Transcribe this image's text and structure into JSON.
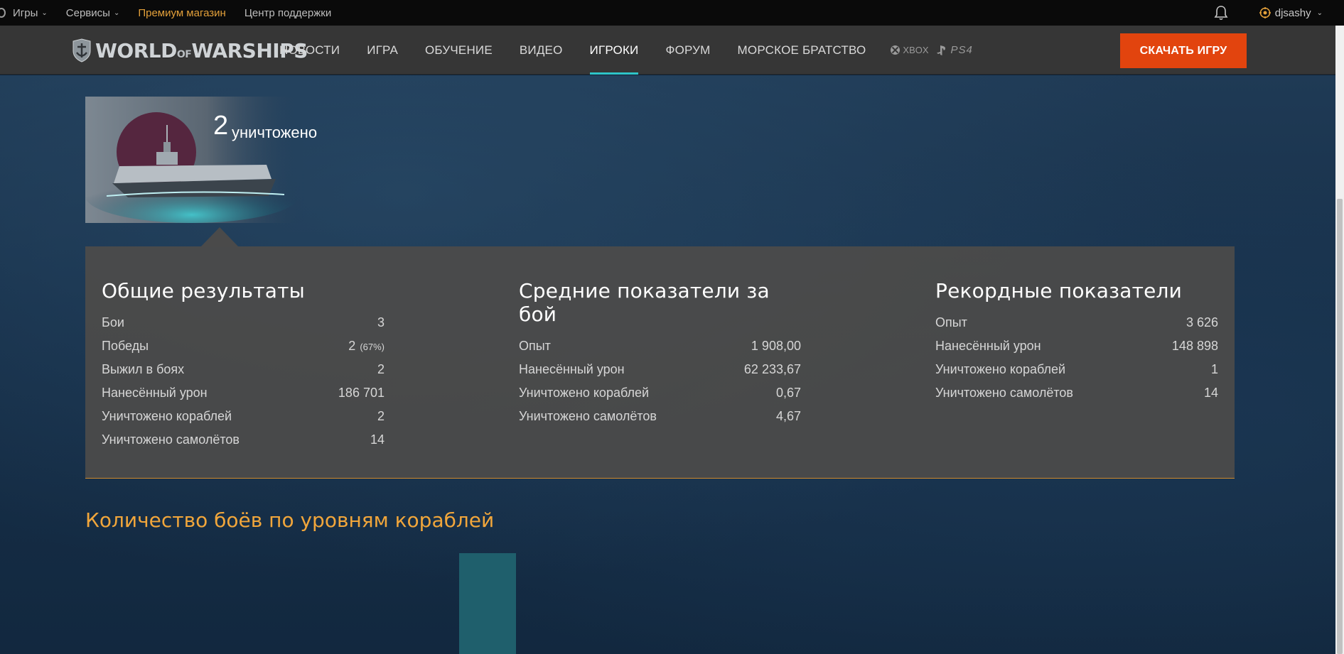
{
  "topbar": {
    "items": [
      {
        "label": "Игры",
        "dropdown": true
      },
      {
        "label": "Сервисы",
        "dropdown": true
      },
      {
        "label": "Премиум магазин",
        "dropdown": false,
        "color": "#e3a03a"
      },
      {
        "label": "Центр поддержки",
        "dropdown": false
      }
    ],
    "username": "djsashy",
    "icons": [
      "bell-icon",
      "user-icon"
    ]
  },
  "nav": {
    "brand": "WORLD OF WARSHIPS",
    "brand_parts": {
      "world": "WORLD",
      "of": "OF",
      "warships": "WARSHIPS"
    },
    "links": [
      "НОВОСТИ",
      "ИГРА",
      "ОБУЧЕНИЕ",
      "ВИДЕО",
      "ИГРОКИ",
      "ФОРУМ",
      "МОРСКОЕ БРАТСТВО"
    ],
    "active_link": "ИГРОКИ",
    "active_color": "#2ec4c8",
    "platforms": {
      "xbox": "XBOX",
      "ps4": "PS4"
    },
    "download_button": "СКАЧАТЬ ИГРУ",
    "download_color": "#e2440e"
  },
  "ship_card": {
    "kill_count": "2",
    "kill_label": "уничтожено"
  },
  "stats": {
    "overall": {
      "title": "Общие результаты",
      "rows": [
        {
          "label": "Бои",
          "value": "3",
          "extra": ""
        },
        {
          "label": "Победы",
          "value": "2",
          "extra": "(67%)"
        },
        {
          "label": "Выжил в боях",
          "value": "2",
          "extra": ""
        },
        {
          "label": "Нанесённый урон",
          "value": "186 701",
          "extra": ""
        },
        {
          "label": "Уничтожено кораблей",
          "value": "2",
          "extra": ""
        },
        {
          "label": "Уничтожено самолётов",
          "value": "14",
          "extra": ""
        }
      ]
    },
    "average": {
      "title": "Средние показатели за бой",
      "rows": [
        {
          "label": "Опыт",
          "value": "1 908,00"
        },
        {
          "label": "Нанесённый урон",
          "value": "62 233,67"
        },
        {
          "label": "Уничтожено кораблей",
          "value": "0,67"
        },
        {
          "label": "Уничтожено самолётов",
          "value": "4,67"
        }
      ]
    },
    "record": {
      "title": "Рекордные показатели",
      "rows": [
        {
          "label": "Опыт",
          "value": "3 626"
        },
        {
          "label": "Нанесённый урон",
          "value": "148 898"
        },
        {
          "label": "Уничтожено кораблей",
          "value": "1"
        },
        {
          "label": "Уничтожено самолётов",
          "value": "14"
        }
      ]
    },
    "accent_color": "#d08a2c"
  },
  "tier_section": {
    "title": "Количество боёв по уровням кораблей",
    "title_color": "#f1a63b",
    "bar_color": "#1f5f6c"
  }
}
